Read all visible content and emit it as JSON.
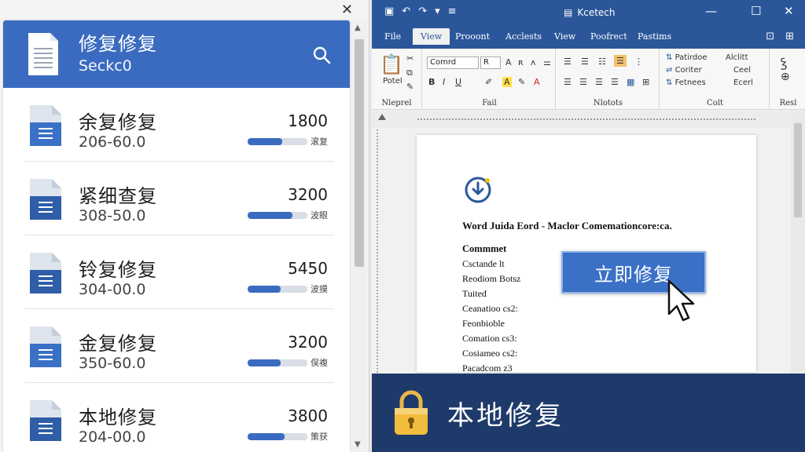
{
  "left": {
    "header": {
      "title": "修复修复",
      "subtitle": "Seckc0"
    },
    "items": [
      {
        "name": "余复修复",
        "sub": "206-60.0",
        "num": "1800",
        "progress": 0.58,
        "tag": "滚复"
      },
      {
        "name": "紧细查复",
        "sub": "308-50.0",
        "num": "3200",
        "progress": 0.75,
        "tag": "波眼"
      },
      {
        "name": "铃复修复",
        "sub": "304-00.0",
        "num": "5450",
        "progress": 0.55,
        "tag": "波摸"
      },
      {
        "name": "金复修复",
        "sub": "350-60.0",
        "num": "3200",
        "progress": 0.55,
        "tag": "俣複"
      },
      {
        "name": "本地修复",
        "sub": "204-00.0",
        "num": "3800",
        "progress": 0.62,
        "tag": "策获"
      }
    ]
  },
  "word": {
    "doc_title": "Kcetech",
    "tabs": [
      "File",
      "View",
      "Prooont",
      "Acclests",
      "View",
      "Poofrect",
      "Pastims"
    ],
    "active_tab": 1,
    "ribbon": {
      "paste": "Potel",
      "font_name": "Comrd",
      "font_size": "R",
      "group1": "Nleprel",
      "group2": "Fail",
      "group3": "Nlotots",
      "group4": "Colt",
      "group5": "Resl",
      "styles": [
        "Patirdoe",
        "Coriter",
        "Fetnees"
      ],
      "right_styles": [
        "Alclitt",
        "Ceel",
        "Ecerl"
      ]
    },
    "page": {
      "heading": "Word Juida Eord -   Maclor Comemationcore:ca.",
      "lines": [
        "Commmet",
        "Csctande lt",
        "Reodiom Botsz",
        "Tuited",
        "Ceanatioo cs2:",
        "Feonbioble",
        "Comation cs3:",
        "Cosiameo cs2:",
        "Pacadcom z3"
      ],
      "button": "立即修复"
    },
    "banner": "本地修复"
  },
  "colors": {
    "accent": "#3a6bc0",
    "word_blue": "#2b579a",
    "banner": "#1e3a6b"
  }
}
